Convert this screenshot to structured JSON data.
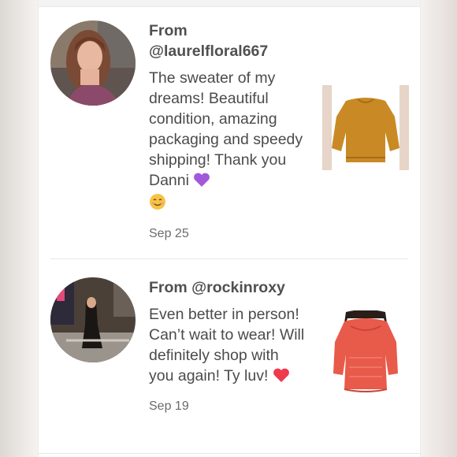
{
  "reviews": [
    {
      "from_label": "From",
      "handle": "@laurelfloral667",
      "text": "The sweater of my dreams! Beautiful condition, amazing packaging and speedy shipping! Thank you Danni",
      "emoji": [
        "purple-heart",
        "smiling-face"
      ],
      "date": "Sep 25"
    },
    {
      "from_label": "From @rockinroxy",
      "text": "Even better in person! Can’t wait to wear! Will definitely shop with you again! Ty luv!",
      "emoji": [
        "red-heart"
      ],
      "date": "Sep 19"
    }
  ],
  "colors": {
    "card_bg": "#ffffff",
    "text": "#4b4b4b",
    "purple_heart": "#a259d9",
    "red_heart": "#ee3a4d",
    "smile_face": "#f6c445",
    "mustard_sweater": "#c98a25",
    "coral_sweater": "#e85a4a"
  }
}
